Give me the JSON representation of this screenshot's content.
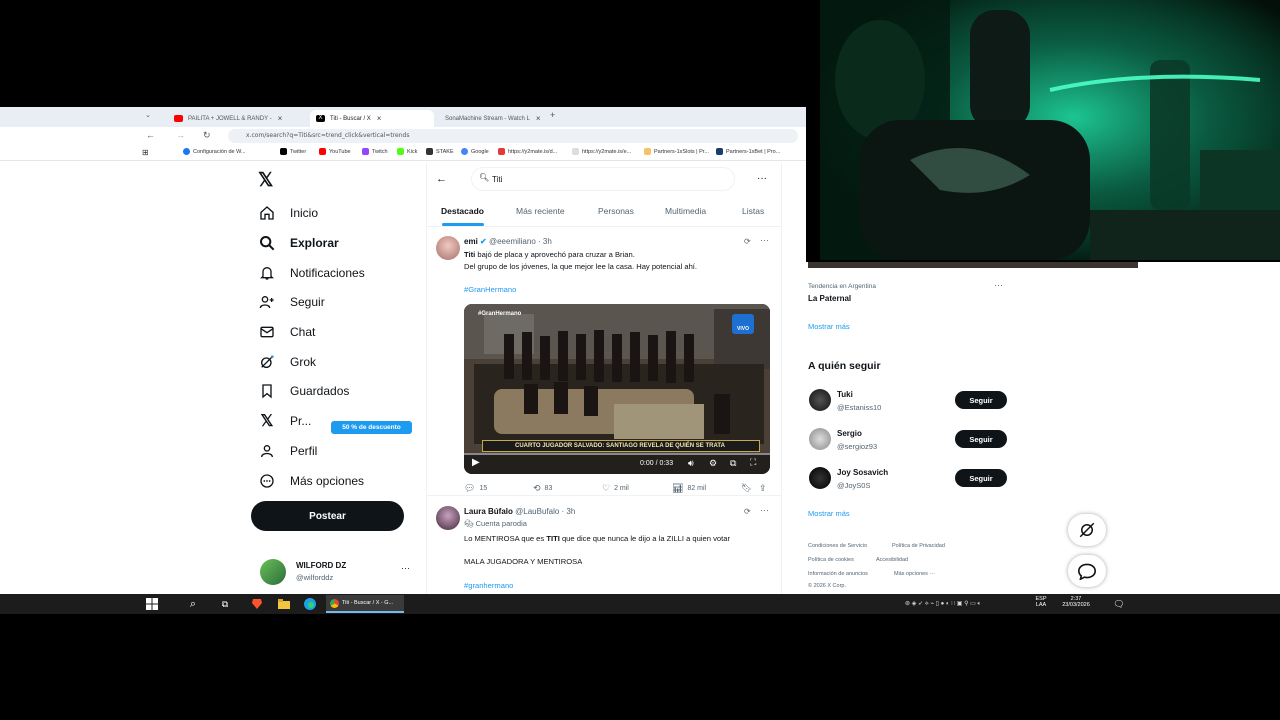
{
  "colors": {
    "accent": "#1d9bf0",
    "text": "#0f1419",
    "muted": "#536471",
    "premium_badge": "#1d9bf0",
    "taskbar": "#1c1c1c",
    "webcam_green": "#1fd9a0"
  },
  "browser": {
    "tabs": [
      {
        "label": "PAILITA + JOWELL & RANDY -",
        "icon": "youtube-icon"
      },
      {
        "label": "Titi - Buscar / X",
        "icon": "x-icon"
      },
      {
        "label": "SonaMachine Stream - Watch L",
        "icon": "kick-icon"
      }
    ],
    "url": "x.com/search?q=Titi&src=trend_click&vertical=trends",
    "bookmarks": [
      "Configuración de W...",
      "Twitter",
      "YouTube",
      "Twitch",
      "Kick",
      "STAKE",
      "Google",
      "https://y2mate.is/d...",
      "https://y2mate.is/e...",
      "Partners-1xSlots | Pr...",
      "Partners-1xBet | Pro..."
    ]
  },
  "nav": {
    "items": [
      {
        "label": "Inicio",
        "icon": "home-icon"
      },
      {
        "label": "Explorar",
        "icon": "search-icon"
      },
      {
        "label": "Notificaciones",
        "icon": "bell-icon"
      },
      {
        "label": "Seguir",
        "icon": "follow-icon"
      },
      {
        "label": "Chat",
        "icon": "mail-icon"
      },
      {
        "label": "Grok",
        "icon": "grok-icon"
      },
      {
        "label": "Guardados",
        "icon": "bookmark-icon"
      },
      {
        "label": "Pr...",
        "icon": "x-premium-icon"
      },
      {
        "label": "Perfil",
        "icon": "person-icon"
      },
      {
        "label": "Más opciones",
        "icon": "more-circle-icon"
      }
    ],
    "premium_badge": "50 % de descuento",
    "post_button": "Postear",
    "account": {
      "name": "WILFORD DZ",
      "handle": "@wilforddz"
    }
  },
  "search": {
    "query": "Titi"
  },
  "filter_tabs": [
    "Destacado",
    "Más reciente",
    "Personas",
    "Multimedia",
    "Listas"
  ],
  "tweets": [
    {
      "name": "emi",
      "handle": "@eeemiliano · 3h",
      "lines": [
        "bajó de placa y aprovechó para cruzar a Brian.",
        "Del grupo de los jóvenes, la que mejor lee la casa. Hay potencial ahí."
      ],
      "bold_word": "Titi",
      "hashtag": "#GranHermano",
      "video": {
        "tag": "#GranHermano",
        "live": "VIVO",
        "caption": "CUARTO JUGADOR SALVADO: SANTIAGO REVELA DE QUIÉN SE TRATA",
        "time": "0:00 / 0:33"
      },
      "stats": {
        "replies": "15",
        "reposts": "83",
        "likes": "2 mil",
        "views": "82 mil"
      }
    },
    {
      "name": "Laura Búfalo",
      "handle": "@LauBufalo · 3h",
      "badge": "Cuenta parodia",
      "line1_pre": "Lo MENTIROSA que es",
      "bold_word": "TITI",
      "line1_post": "que dice que nunca le dijo a la ZILLI a quien votar",
      "line2": "MALA JUGADORA Y MENTIROSA",
      "hashtag": "#granhermano"
    }
  ],
  "right": {
    "trend": {
      "context": "Tendencia en Argentina",
      "name": "La Paternal"
    },
    "show_more": "Mostrar más",
    "who_to_follow": {
      "title": "A quién seguir",
      "button": "Seguir",
      "users": [
        {
          "name": "Tuki",
          "handle": "@Estaniss10"
        },
        {
          "name": "Sergio",
          "handle": "@sergioz93"
        },
        {
          "name": "Joy Sosavich",
          "handle": "@JoyS0S"
        }
      ]
    },
    "footer": [
      "Condiciones de Servicio",
      "Política de Privacidad",
      "Política de cookies",
      "Accesibilidad",
      "Información de anuncios",
      "Más opciones ···",
      "© 2026 X Corp."
    ]
  },
  "taskbar": {
    "active_task": "Titi - Buscar / X - G...",
    "lang": "ESP",
    "lang2": "LAA",
    "time": "2:37",
    "date": "23/03/2026"
  }
}
